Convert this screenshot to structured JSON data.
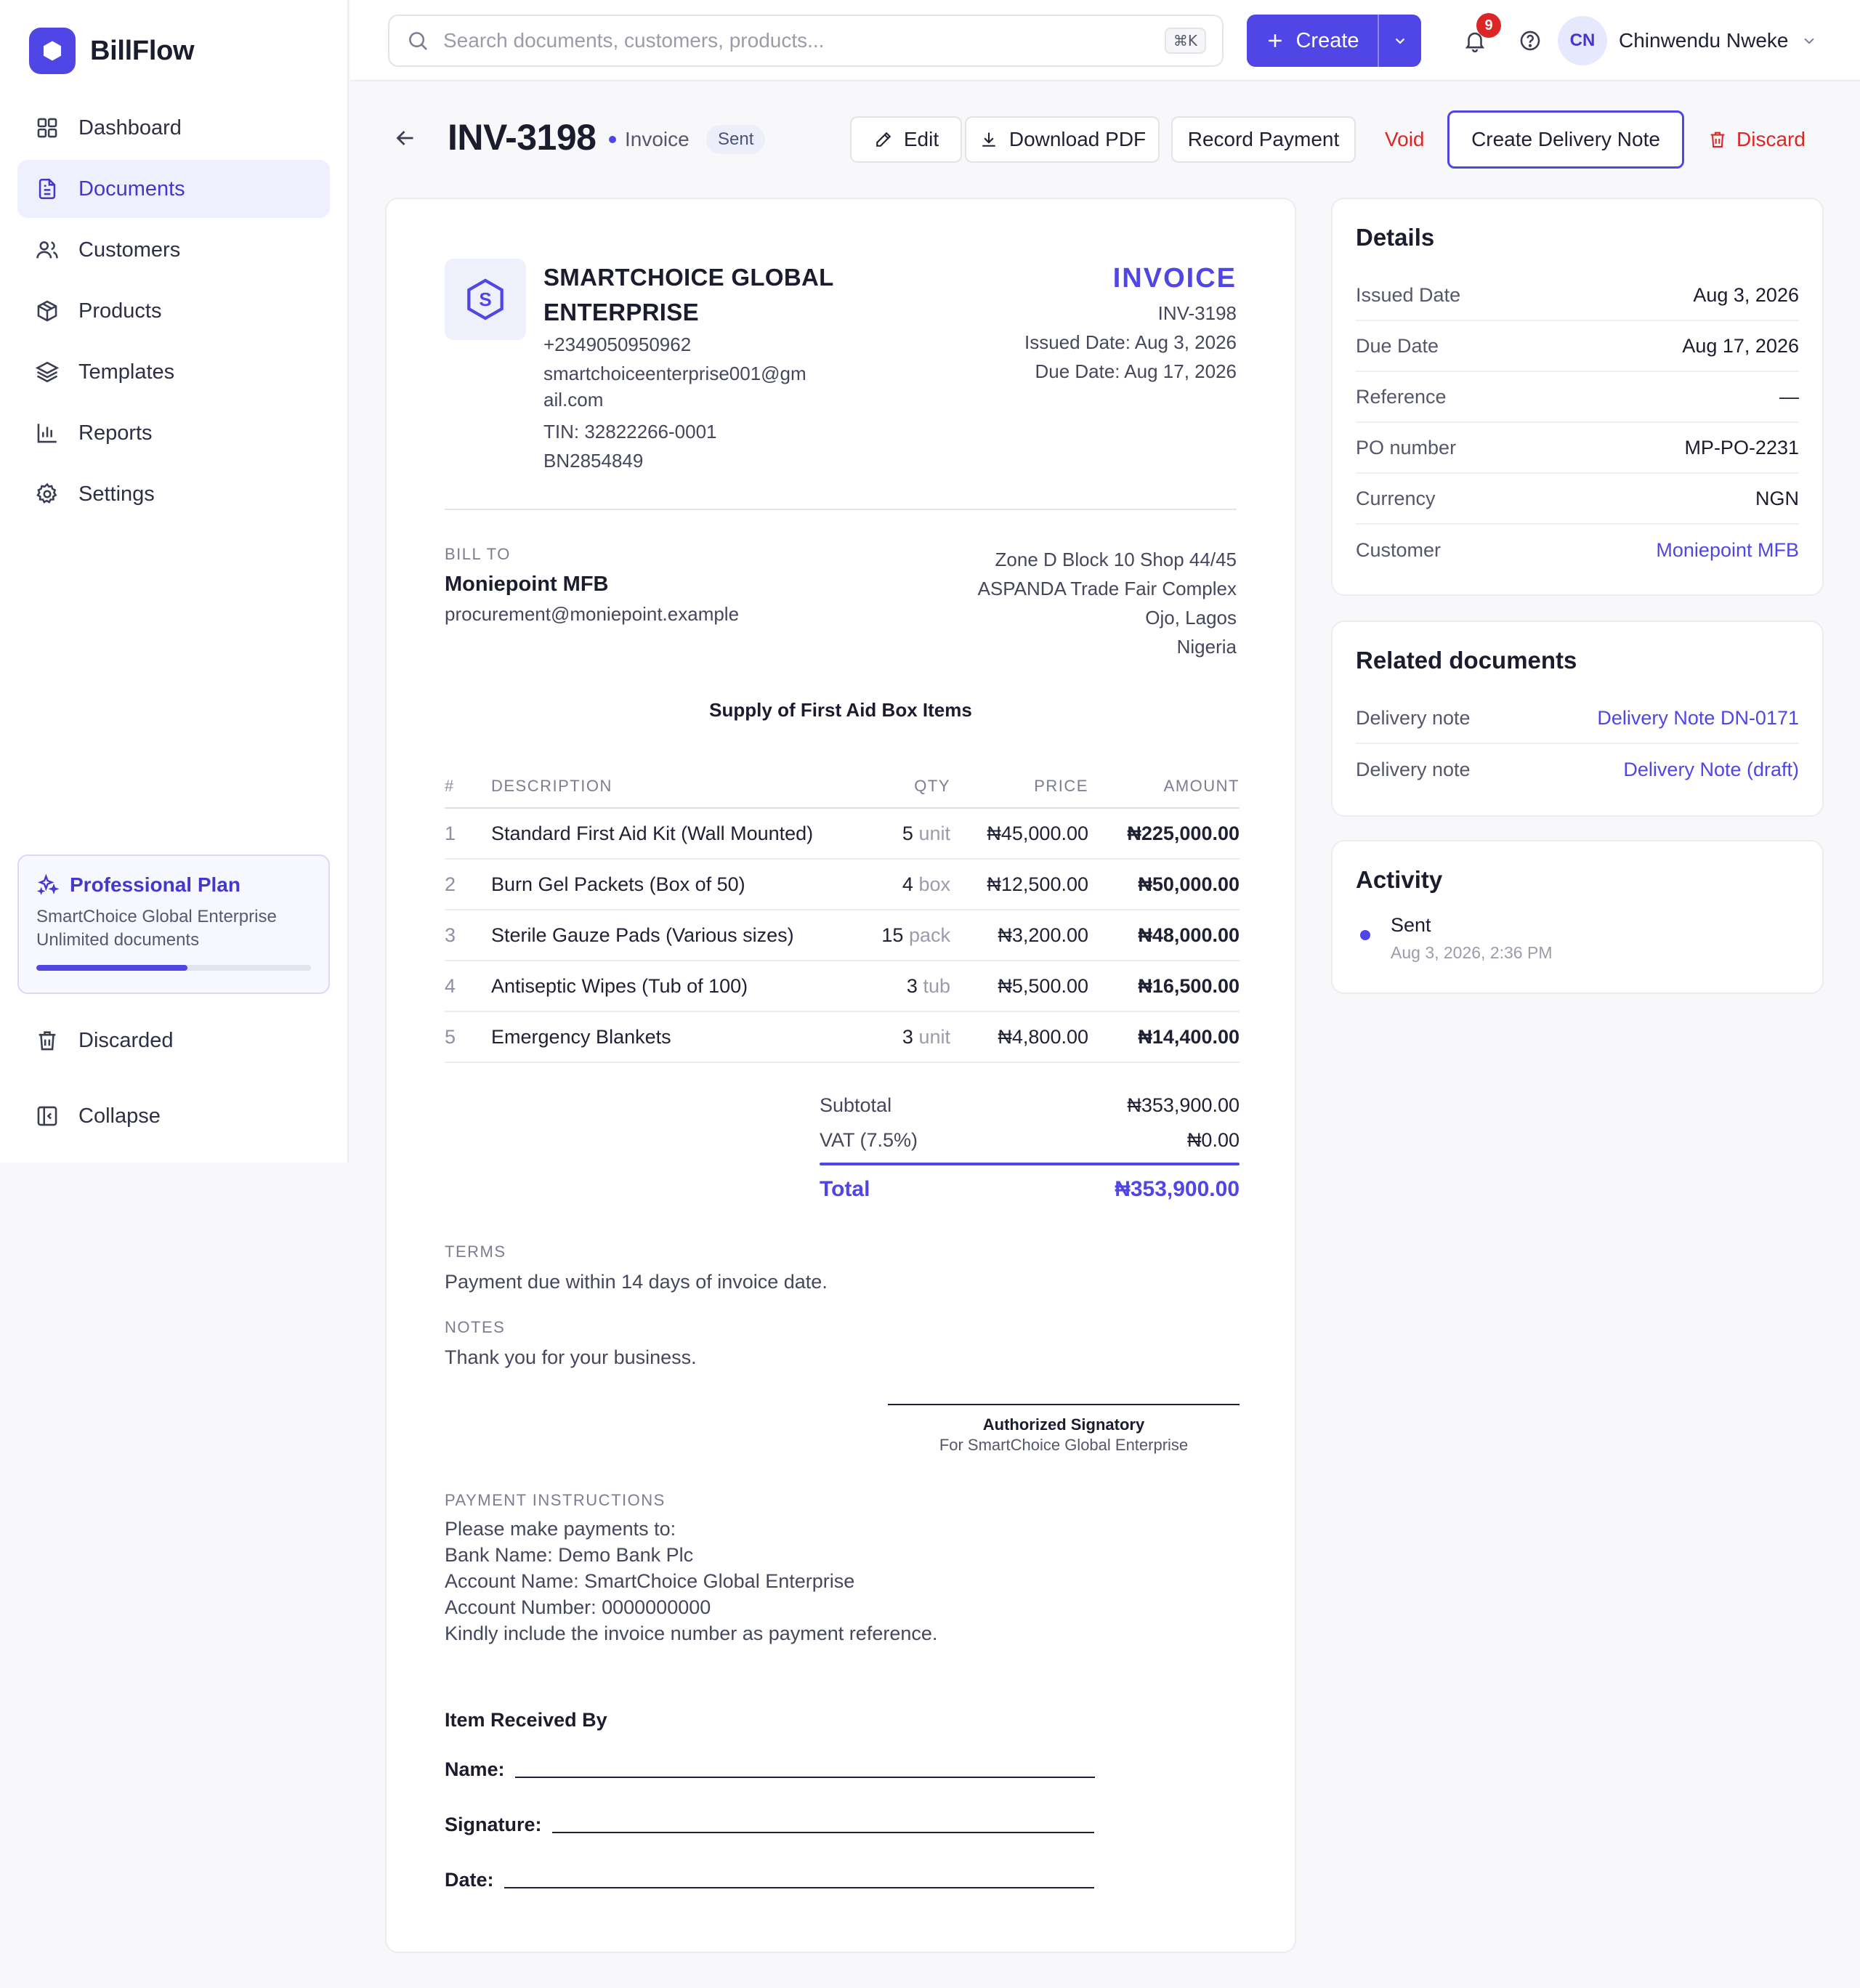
{
  "app": {
    "name": "BillFlow"
  },
  "sidebar": {
    "items": [
      {
        "label": "Dashboard",
        "icon": "grid-icon"
      },
      {
        "label": "Documents",
        "icon": "document-icon",
        "active": true
      },
      {
        "label": "Customers",
        "icon": "users-icon"
      },
      {
        "label": "Products",
        "icon": "box-icon"
      },
      {
        "label": "Templates",
        "icon": "layers-icon"
      },
      {
        "label": "Reports",
        "icon": "bar-chart-icon"
      },
      {
        "label": "Settings",
        "icon": "gear-icon"
      }
    ],
    "plan": {
      "title": "Professional Plan",
      "company": "SmartChoice Global Enterprise",
      "limit": "Unlimited documents",
      "usage_fraction": 0.55
    },
    "discarded_label": "Discarded",
    "collapse_label": "Collapse"
  },
  "topbar": {
    "search_placeholder": "Search documents, customers, products...",
    "shortcut": "⌘K",
    "create_label": "Create",
    "notification_count": "9",
    "user_initials": "CN",
    "user_name": "Chinwendu Nweke"
  },
  "header": {
    "doc_number": "INV-3198",
    "doc_type": "Invoice",
    "status": "Sent",
    "actions": {
      "edit": "Edit",
      "download": "Download PDF",
      "record_payment": "Record Payment",
      "void": "Void",
      "create_delivery_note": "Create Delivery Note",
      "discard": "Discard"
    }
  },
  "invoice": {
    "company": {
      "logo_letter": "S",
      "name_line1": "SMARTCHOICE GLOBAL",
      "name_line2": "ENTERPRISE",
      "phone": "+2349050950962",
      "email_line1": "smartchoiceenterprise001@gm",
      "email_line2": "ail.com",
      "tin": "TIN: 32822266-0001",
      "bn": "BN2854849"
    },
    "title": "INVOICE",
    "number": "INV-3198",
    "issued": "Issued Date: Aug 3, 2026",
    "due": "Due Date: Aug 17, 2026",
    "bill_to_label": "BILL TO",
    "bill_to": {
      "name": "Moniepoint MFB",
      "email": "procurement@moniepoint.example",
      "address": [
        "Zone D Block 10 Shop 44/45",
        "ASPANDA Trade Fair Complex",
        "Ojo, Lagos",
        "Nigeria"
      ]
    },
    "subject": "Supply of First Aid Box Items",
    "columns": {
      "num": "#",
      "description": "DESCRIPTION",
      "qty": "QTY",
      "price": "PRICE",
      "amount": "AMOUNT"
    },
    "items": [
      {
        "num": "1",
        "description": "Standard First Aid Kit (Wall Mounted)",
        "qty": "5",
        "unit": "unit",
        "price": "₦45,000.00",
        "amount": "₦225,000.00"
      },
      {
        "num": "2",
        "description": "Burn Gel Packets (Box of 50)",
        "qty": "4",
        "unit": "box",
        "price": "₦12,500.00",
        "amount": "₦50,000.00"
      },
      {
        "num": "3",
        "description": "Sterile Gauze Pads (Various sizes)",
        "qty": "15",
        "unit": "pack",
        "price": "₦3,200.00",
        "amount": "₦48,000.00"
      },
      {
        "num": "4",
        "description": "Antiseptic Wipes (Tub of 100)",
        "qty": "3",
        "unit": "tub",
        "price": "₦5,500.00",
        "amount": "₦16,500.00"
      },
      {
        "num": "5",
        "description": "Emergency Blankets",
        "qty": "3",
        "unit": "unit",
        "price": "₦4,800.00",
        "amount": "₦14,400.00"
      }
    ],
    "subtotal_label": "Subtotal",
    "subtotal": "₦353,900.00",
    "vat_label": "VAT (7.5%)",
    "vat": "₦0.00",
    "total_label": "Total",
    "total": "₦353,900.00",
    "terms_label": "TERMS",
    "terms": "Payment due within 14 days of invoice date.",
    "notes_label": "NOTES",
    "notes": "Thank you for your business.",
    "signatory_title": "Authorized Signatory",
    "signatory_sub": "For SmartChoice Global Enterprise",
    "payment_label": "PAYMENT INSTRUCTIONS",
    "payment_lines": [
      "Please make payments to:",
      "Bank Name: Demo Bank Plc",
      "Account Name: SmartChoice Global Enterprise",
      "Account Number: 0000000000"
    ],
    "payment_note": "Kindly include the invoice number as payment reference.",
    "received_title": "Item Received By",
    "received_name": "Name:",
    "received_signature": "Signature:",
    "received_date": "Date:"
  },
  "details": {
    "title": "Details",
    "rows": [
      {
        "label": "Issued Date",
        "value": "Aug 3, 2026"
      },
      {
        "label": "Due Date",
        "value": "Aug 17, 2026"
      },
      {
        "label": "Reference",
        "value": "—"
      },
      {
        "label": "PO number",
        "value": "MP-PO-2231"
      },
      {
        "label": "Currency",
        "value": "NGN"
      },
      {
        "label": "Customer",
        "value": "Moniepoint MFB"
      }
    ]
  },
  "related": {
    "title": "Related documents",
    "rows": [
      {
        "label": "Delivery note",
        "value": "Delivery Note DN-0171"
      },
      {
        "label": "Delivery note",
        "value": "Delivery Note (draft)"
      }
    ]
  },
  "activity": {
    "title": "Activity",
    "events": [
      {
        "label": "Sent",
        "time": "Aug 3, 2026, 2:36 PM"
      }
    ]
  },
  "colors": {
    "accent": "#4f46e5",
    "danger": "#dc2626",
    "text": "#1f2033",
    "muted": "#7b7d92"
  }
}
